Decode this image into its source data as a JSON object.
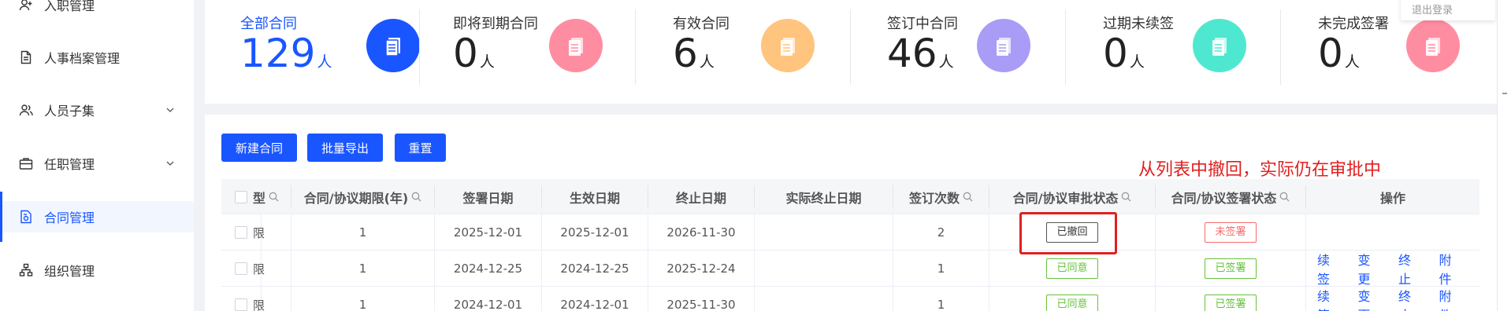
{
  "sidebar": {
    "items": [
      {
        "label": "入职管理",
        "icon": "user-add-icon",
        "chevron": false,
        "active": false
      },
      {
        "label": "人事档案管理",
        "icon": "document-icon",
        "chevron": false,
        "active": false
      },
      {
        "label": "人员子集",
        "icon": "users-icon",
        "chevron": true,
        "active": false
      },
      {
        "label": "任职管理",
        "icon": "briefcase-icon",
        "chevron": true,
        "active": false
      },
      {
        "label": "合同管理",
        "icon": "contract-icon",
        "chevron": false,
        "active": true
      },
      {
        "label": "组织管理",
        "icon": "org-chart-icon",
        "chevron": false,
        "active": false
      }
    ]
  },
  "stats": [
    {
      "title": "全部合同",
      "value": "129",
      "unit": "人",
      "color": "#1a56ff"
    },
    {
      "title": "即将到期合同",
      "value": "0",
      "unit": "人",
      "color": "#ff8da1"
    },
    {
      "title": "有效合同",
      "value": "6",
      "unit": "人",
      "color": "#ffc47e"
    },
    {
      "title": "签订中合同",
      "value": "46",
      "unit": "人",
      "color": "#a99cf6"
    },
    {
      "title": "过期未续签",
      "value": "0",
      "unit": "人",
      "color": "#4ee8d0"
    },
    {
      "title": "未完成签署",
      "value": "0",
      "unit": "人",
      "color": "#ff8da1"
    }
  ],
  "header": {
    "logout_label": "退出登录"
  },
  "toolbar": {
    "new_label": "新建合同",
    "export_label": "批量导出",
    "reset_label": "重置"
  },
  "annotation": {
    "text": "从列表中撤回，实际仍在审批中",
    "color": "#e02020"
  },
  "table": {
    "columns": [
      "型",
      "合同/协议期限(年)",
      "签署日期",
      "生效日期",
      "终止日期",
      "实际终止日期",
      "签订次数",
      "合同/协议审批状态",
      "合同/协议签署状态",
      "操作"
    ],
    "rows": [
      {
        "type": "限",
        "term": "1",
        "sign_date": "2025-12-01",
        "effective_date": "2025-12-01",
        "end_date": "2026-11-30",
        "actual_end": "",
        "count": "2",
        "approval": "已撤回",
        "approval_style": "gray",
        "signing": "未签署",
        "signing_style": "orange",
        "actions": []
      },
      {
        "type": "限",
        "term": "1",
        "sign_date": "2024-12-25",
        "effective_date": "2024-12-25",
        "end_date": "2025-12-24",
        "actual_end": "",
        "count": "1",
        "approval": "已同意",
        "approval_style": "green",
        "signing": "已签署",
        "signing_style": "green",
        "actions": [
          "续签",
          "变更",
          "终止",
          "附件"
        ]
      },
      {
        "type": "限",
        "term": "1",
        "sign_date": "2024-12-01",
        "effective_date": "2024-12-01",
        "end_date": "2025-11-30",
        "actual_end": "",
        "count": "1",
        "approval": "已同意",
        "approval_style": "green",
        "signing": "已签署",
        "signing_style": "green",
        "actions": [
          "续签",
          "变更",
          "终止",
          "附件"
        ]
      }
    ]
  }
}
